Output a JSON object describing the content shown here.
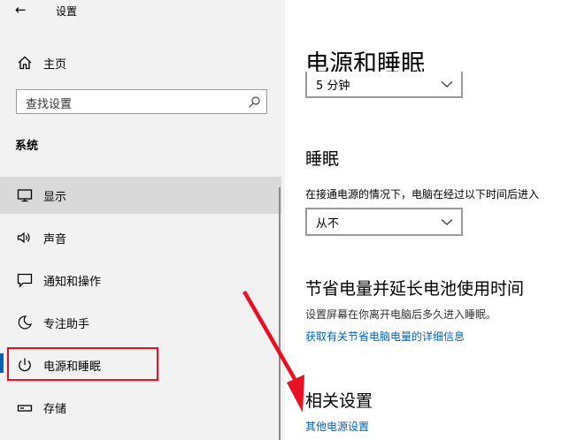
{
  "window": {
    "back_glyph": "←",
    "title": "设置"
  },
  "sidebar": {
    "home_label": "主页",
    "search_placeholder": "查找设置",
    "section_label": "系统",
    "items": [
      {
        "label": "显示",
        "icon": "monitor-icon"
      },
      {
        "label": "声音",
        "icon": "speaker-icon"
      },
      {
        "label": "通知和操作",
        "icon": "notification-icon"
      },
      {
        "label": "专注助手",
        "icon": "moon-icon"
      },
      {
        "label": "电源和睡眠",
        "icon": "power-icon"
      },
      {
        "label": "存储",
        "icon": "storage-icon"
      }
    ]
  },
  "main": {
    "page_title": "电源和睡眠",
    "screen_timeout_value": "5 分钟",
    "sleep_heading": "睡眠",
    "sleep_desc": "在接通电源的情况下，电脑在经过以下时间后进入",
    "sleep_value": "从不",
    "save_heading": "节省电量并延长电池使用时间",
    "save_desc": "设置屏幕在你离开电脑后多久进入睡眠。",
    "save_link": "获取有关节省电脑电量的详细信息",
    "related_heading": "相关设置",
    "related_link": "其他电源设置"
  },
  "colors": {
    "accent": "#0063b1",
    "highlight_box": "#e81123",
    "annotation_arrow": "#e81123"
  }
}
